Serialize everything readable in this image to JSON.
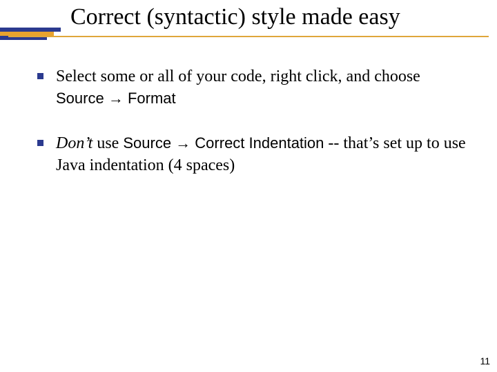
{
  "title": "Correct (syntactic) style made easy",
  "bullets": [
    {
      "pre": "Select some or all of your code, right click, and choose ",
      "menu1": "Source",
      "arrow": " → ",
      "menu2": "Format",
      "post": ""
    },
    {
      "em": "Don’t",
      "mid1": " use ",
      "menu1": "Source",
      "arrow": " → ",
      "menu2": "Correct Indentation",
      "post": " -- that’s set up to use Java indentation (4 spaces)"
    }
  ],
  "page_number": "11"
}
